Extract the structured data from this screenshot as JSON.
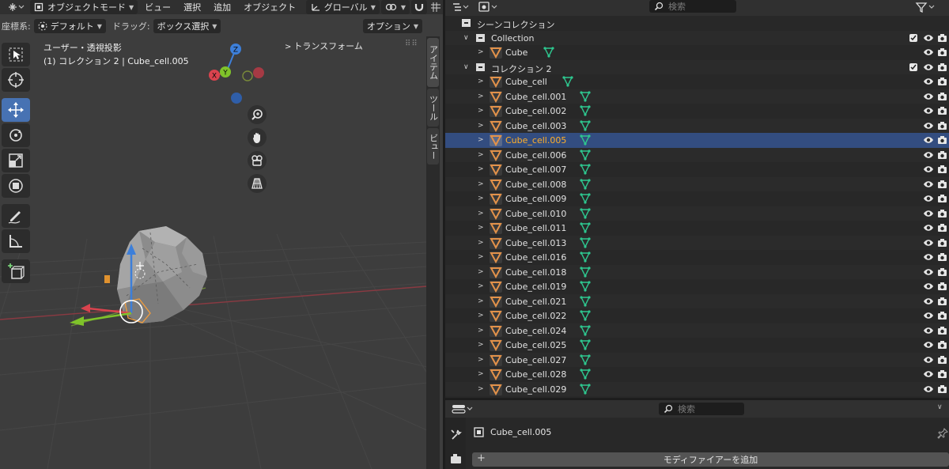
{
  "viewport": {
    "header": {
      "mode_label": "オブジェクトモード",
      "menus": [
        "ビュー",
        "選択",
        "追加",
        "オブジェクト"
      ],
      "orientation_label": "グローバル"
    },
    "header2": {
      "coord_label": "座標系:",
      "coord_value": "デフォルト",
      "drag_label": "ドラッグ:",
      "drag_value": "ボックス選択",
      "options_label": "オプション"
    },
    "info_line1": "ユーザー・透視投影",
    "info_line2": "(1) コレクション 2 | Cube_cell.005",
    "transform_panel": "トランスフォーム",
    "gizmo_axes": {
      "z": "Z",
      "y": "Y",
      "x": "X"
    },
    "n_tabs": [
      "アイテム",
      "ツール",
      "ビュー"
    ]
  },
  "outliner": {
    "search_placeholder": "検索",
    "scene_collection": "シーンコレクション",
    "collection1": "Collection",
    "cube": "Cube",
    "collection2": "コレクション 2",
    "objects": [
      "Cube_cell",
      "Cube_cell.001",
      "Cube_cell.002",
      "Cube_cell.003",
      "Cube_cell.005",
      "Cube_cell.006",
      "Cube_cell.007",
      "Cube_cell.008",
      "Cube_cell.009",
      "Cube_cell.010",
      "Cube_cell.011",
      "Cube_cell.013",
      "Cube_cell.016",
      "Cube_cell.018",
      "Cube_cell.019",
      "Cube_cell.021",
      "Cube_cell.022",
      "Cube_cell.024",
      "Cube_cell.025",
      "Cube_cell.027",
      "Cube_cell.028",
      "Cube_cell.029"
    ],
    "selected_object": "Cube_cell.005"
  },
  "properties": {
    "search_placeholder": "検索",
    "object_name": "Cube_cell.005",
    "add_modifier_label": "モディファイアーを追加"
  },
  "colors": {
    "accent_blue": "#4772b3",
    "selected_row": "#334d80",
    "selected_text": "#ffaf29",
    "mesh_icon": "#2ec78f",
    "object_icon": "#e3924a"
  }
}
